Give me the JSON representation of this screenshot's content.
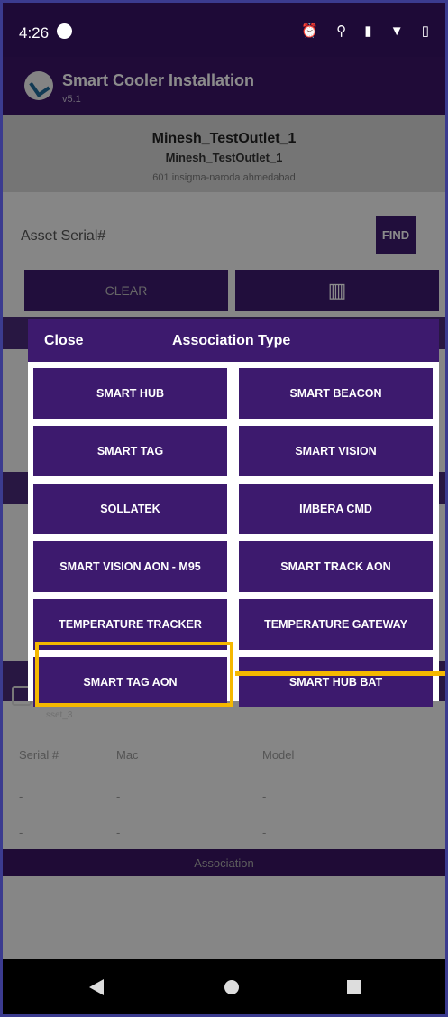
{
  "status_bar": {
    "time": "4:26",
    "icons": "⏰ ⚲ ▮ ▼ ▯"
  },
  "app_bar": {
    "title": "Smart Cooler Installation",
    "version": "v5.1"
  },
  "outlet": {
    "name": "Minesh_TestOutlet_1",
    "code": "Minesh_TestOutlet_1",
    "address": "601 insigma-naroda ahmedabad"
  },
  "asset_search": {
    "label": "Asset Serial#",
    "value": "",
    "find_label": "FIND",
    "clear_label": "CLEAR",
    "scan_icon": "barcode-icon"
  },
  "asset_list": {
    "asset_name": "sset_3",
    "columns": [
      "Serial #",
      "Mac",
      "Model"
    ],
    "rows": [
      [
        "-",
        "-",
        "-"
      ],
      [
        "-",
        "-",
        "-"
      ]
    ],
    "association_label": "Association"
  },
  "dialog": {
    "close_label": "Close",
    "title": "Association Type",
    "options": [
      "SMART HUB",
      "SMART BEACON",
      "SMART TAG",
      "SMART VISION",
      "SOLLATEK",
      "IMBERA CMD",
      "SMART VISION AON - M95",
      "SMART TRACK AON",
      "TEMPERATURE TRACKER",
      "TEMPERATURE GATEWAY",
      "SMART TAG AON",
      "SMART HUB BAT"
    ]
  },
  "colors": {
    "primary": "#3d1a6e",
    "highlight": "#f5b800"
  }
}
